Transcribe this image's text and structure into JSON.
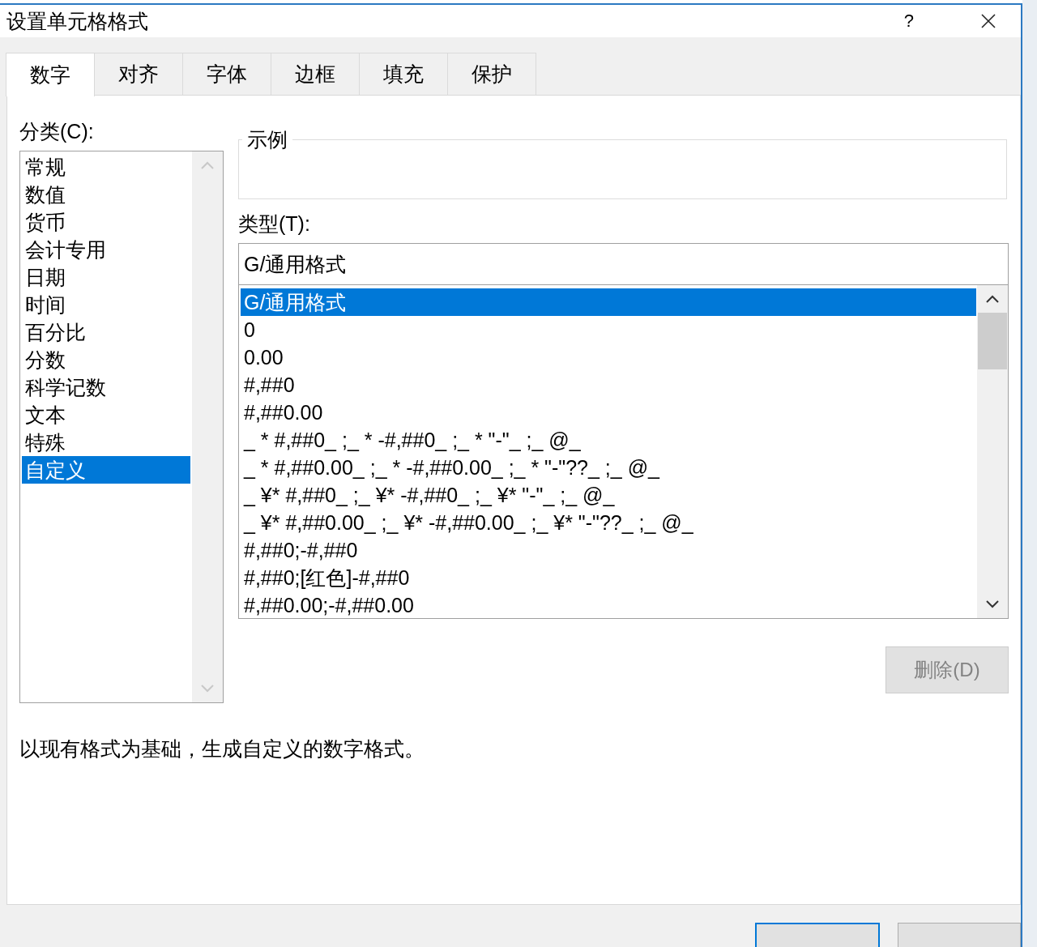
{
  "window": {
    "title": "设置单元格格式",
    "help": "?"
  },
  "tabs": [
    {
      "label": "数字",
      "selected": true
    },
    {
      "label": "对齐",
      "selected": false
    },
    {
      "label": "字体",
      "selected": false
    },
    {
      "label": "边框",
      "selected": false
    },
    {
      "label": "填充",
      "selected": false
    },
    {
      "label": "保护",
      "selected": false
    }
  ],
  "category": {
    "label": "分类(C):",
    "items": [
      {
        "label": "常规",
        "selected": false
      },
      {
        "label": "数值",
        "selected": false
      },
      {
        "label": "货币",
        "selected": false
      },
      {
        "label": "会计专用",
        "selected": false
      },
      {
        "label": "日期",
        "selected": false
      },
      {
        "label": "时间",
        "selected": false
      },
      {
        "label": "百分比",
        "selected": false
      },
      {
        "label": "分数",
        "selected": false
      },
      {
        "label": "科学记数",
        "selected": false
      },
      {
        "label": "文本",
        "selected": false
      },
      {
        "label": "特殊",
        "selected": false
      },
      {
        "label": "自定义",
        "selected": true
      }
    ]
  },
  "sample": {
    "label": "示例"
  },
  "type": {
    "label": "类型(T):",
    "value": "G/通用格式",
    "items": [
      {
        "label": "G/通用格式",
        "selected": true
      },
      {
        "label": "0",
        "selected": false
      },
      {
        "label": "0.00",
        "selected": false
      },
      {
        "label": "#,##0",
        "selected": false
      },
      {
        "label": "#,##0.00",
        "selected": false
      },
      {
        "label": "_ * #,##0_ ;_ * -#,##0_ ;_ * \"-\"_ ;_ @_",
        "selected": false
      },
      {
        "label": "_ * #,##0.00_ ;_ * -#,##0.00_ ;_ * \"-\"??_ ;_ @_",
        "selected": false
      },
      {
        "label": "_ ¥* #,##0_ ;_ ¥* -#,##0_ ;_ ¥* \"-\"_ ;_ @_",
        "selected": false
      },
      {
        "label": "_ ¥* #,##0.00_ ;_ ¥* -#,##0.00_ ;_ ¥* \"-\"??_ ;_ @_",
        "selected": false
      },
      {
        "label": "#,##0;-#,##0",
        "selected": false
      },
      {
        "label": "#,##0;[红色]-#,##0",
        "selected": false
      },
      {
        "label": "#,##0.00;-#,##0.00",
        "selected": false
      }
    ]
  },
  "delete_button": {
    "label": "删除(D)",
    "disabled": true
  },
  "description": "以现有格式为基础，生成自定义的数字格式。"
}
